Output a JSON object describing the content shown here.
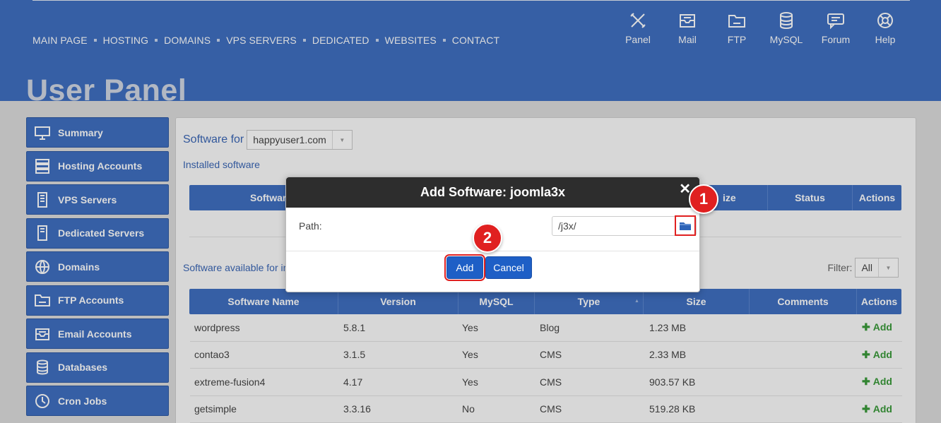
{
  "nav": {
    "items": [
      "MAIN PAGE",
      "HOSTING",
      "DOMAINS",
      "VPS SERVERS",
      "DEDICATED",
      "WEBSITES",
      "CONTACT"
    ]
  },
  "top_icons": [
    {
      "label": "Panel",
      "icon": "tools-icon"
    },
    {
      "label": "Mail",
      "icon": "mail-icon"
    },
    {
      "label": "FTP",
      "icon": "ftp-folder-icon"
    },
    {
      "label": "MySQL",
      "icon": "database-icon"
    },
    {
      "label": "Forum",
      "icon": "forum-icon"
    },
    {
      "label": "Help",
      "icon": "lifebuoy-icon"
    }
  ],
  "page_title": "User Panel",
  "sidebar": {
    "items": [
      {
        "label": "Summary",
        "icon": "monitor-icon"
      },
      {
        "label": "Hosting Accounts",
        "icon": "server-icon"
      },
      {
        "label": "VPS Servers",
        "icon": "vps-icon"
      },
      {
        "label": "Dedicated Servers",
        "icon": "dedicated-icon"
      },
      {
        "label": "Domains",
        "icon": "globe-icon"
      },
      {
        "label": "FTP Accounts",
        "icon": "ftp-icon"
      },
      {
        "label": "Email Accounts",
        "icon": "email-icon"
      },
      {
        "label": "Databases",
        "icon": "database-icon"
      },
      {
        "label": "Cron Jobs",
        "icon": "clock-icon"
      }
    ]
  },
  "content": {
    "software_for_label": "Software for",
    "domain_value": "happyuser1.com",
    "installed_label": "Installed software",
    "installed_headers": [
      "Softwar",
      "ize",
      "Status",
      "Actions"
    ],
    "available_label": "Software available for in",
    "filter_label": "Filter:",
    "filter_value": "All",
    "available_headers": [
      "Software Name",
      "Version",
      "MySQL",
      "Type",
      "Size",
      "Comments",
      "Actions"
    ],
    "rows": [
      {
        "name": "wordpress",
        "version": "5.8.1",
        "mysql": "Yes",
        "type": "Blog",
        "size": "1.23 MB",
        "action": "Add"
      },
      {
        "name": "contao3",
        "version": "3.1.5",
        "mysql": "Yes",
        "type": "CMS",
        "size": "2.33 MB",
        "action": "Add"
      },
      {
        "name": "extreme-fusion4",
        "version": "4.17",
        "mysql": "Yes",
        "type": "CMS",
        "size": "903.57 KB",
        "action": "Add"
      },
      {
        "name": "getsimple",
        "version": "3.3.16",
        "mysql": "No",
        "type": "CMS",
        "size": "519.28 KB",
        "action": "Add"
      }
    ]
  },
  "modal": {
    "title": "Add Software: joomla3x",
    "close": "✕",
    "path_label": "Path:",
    "path_value": "/j3x/",
    "add_label": "Add",
    "cancel_label": "Cancel"
  },
  "badges": {
    "one": "1",
    "two": "2"
  },
  "colors": {
    "brand_blue": "#3f6fc0",
    "button_blue": "#1e5fc6",
    "highlight_red": "#e02020",
    "add_green": "#3a9a3a"
  }
}
